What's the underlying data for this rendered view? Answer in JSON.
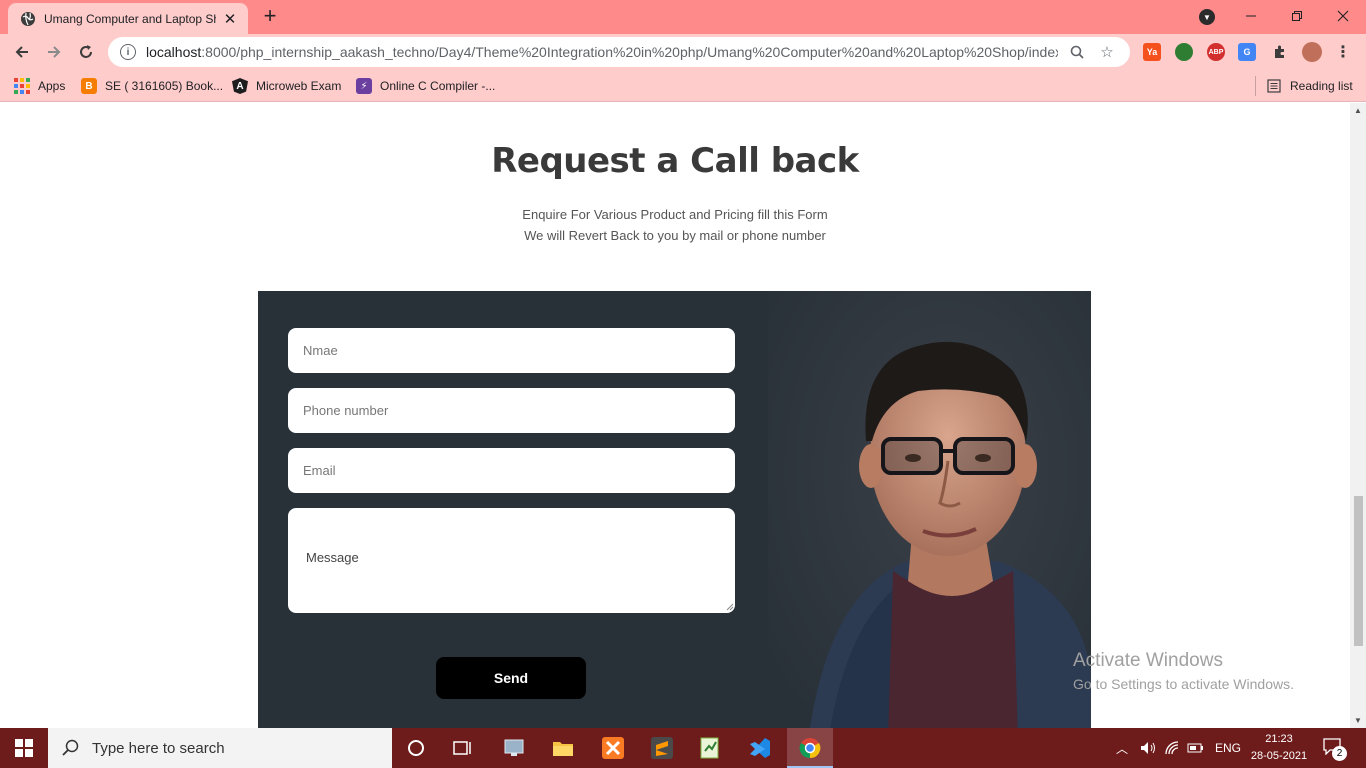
{
  "browser": {
    "tab_title": "Umang Computer and Laptop Sh",
    "tab_close": "✕",
    "new_tab": "+",
    "url_host": "localhost",
    "url_path": ":8000/php_internship_aakash_techno/Day4/Theme%20Integration%20in%20php/Umang%20Computer%20and%20Laptop%20Shop/index...",
    "bookmarks": [
      {
        "label": "Apps",
        "icon": "apps-grid-icon"
      },
      {
        "label": "SE ( 3161605) Book...",
        "icon": "blogger-icon",
        "color": "#f57d00"
      },
      {
        "label": "Microweb Exam",
        "icon": "angular-icon",
        "color": "#1d1d1d"
      },
      {
        "label": "Online C Compiler -...",
        "icon": "lightning-icon",
        "color": "#6b3fa0"
      }
    ],
    "reading_list": "Reading list",
    "extensions": [
      {
        "name": "ya-extension-icon",
        "label": "Ya",
        "color": "#f4511e"
      },
      {
        "name": "globe-extension-icon",
        "label": "",
        "color": "#2e7d32"
      },
      {
        "name": "adblock-extension-icon",
        "label": "ABP",
        "color": "#d32f2f"
      },
      {
        "name": "translate-extension-icon",
        "label": "G",
        "color": "#4285f4"
      }
    ]
  },
  "page": {
    "heading": "Request a Call back",
    "subtitle_line1": "Enquire For Various Product and Pricing fill this Form",
    "subtitle_line2": "We will Revert Back to you by mail or phone number",
    "form": {
      "name_placeholder": "Nmae",
      "phone_placeholder": "Phone number",
      "email_placeholder": "Email",
      "message_placeholder": "Message",
      "send_label": "Send"
    },
    "panel_color": "#283038"
  },
  "watermark": {
    "line1": "Activate Windows",
    "line2": "Go to Settings to activate Windows."
  },
  "taskbar": {
    "search_placeholder": "Type here to search",
    "language": "ENG",
    "time": "21:23",
    "date": "28-05-2021",
    "notification_count": "2",
    "accent": "#6e1b1b"
  }
}
